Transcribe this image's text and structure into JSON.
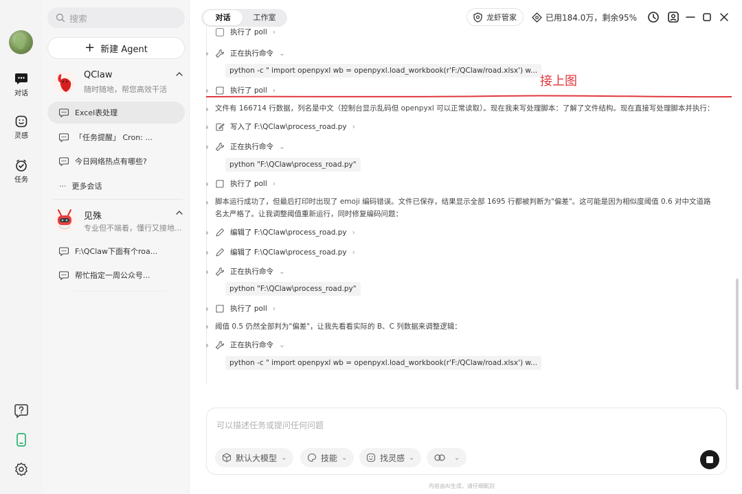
{
  "rail": {
    "items": [
      {
        "label": "对话",
        "icon": "chat-bubble-icon"
      },
      {
        "label": "灵感",
        "icon": "smile-icon"
      },
      {
        "label": "任务",
        "icon": "check-clock-icon"
      }
    ],
    "bottom_icons": [
      "help-icon",
      "phone-icon",
      "settings-icon"
    ]
  },
  "sidebar": {
    "search_placeholder": "搜索",
    "new_agent": "新建 Agent",
    "agents": [
      {
        "name": "QClaw",
        "desc": "随时随地，帮您高效干活",
        "conversations": [
          "Excel表处理",
          "「任务提醒」 Cron: ...",
          "今日网络热点有哪些?"
        ]
      },
      {
        "name": "见殊",
        "desc": "专业但不端着，懂行又接地...",
        "conversations": [
          "F:\\QClaw下面有个roa...",
          "帮忙指定一周公众号..."
        ]
      }
    ],
    "more": "更多会话",
    "active_conversation": "Excel表处理"
  },
  "header": {
    "tabs": [
      "对话",
      "工作室"
    ],
    "active_tab": "对话",
    "manager": "龙虾管家",
    "usage": "已用184.0万，剩余95%"
  },
  "timeline": {
    "annotation": "接上图",
    "annotation_color": "#e0383d",
    "items": {
      "r0": "执行了 poll",
      "r1": "正在执行命令",
      "c1": "python -c \" import openpyxl wb = openpyxl.load_workbook(r'F:/QClaw/road.xlsx') w...",
      "r2": "执行了 poll",
      "p1": "文件有 166714 行数据，列名是中文（控制台显示乱码但 openpyxl 可以正常读取）。现在我来写处理脚本：了解了文件结构。现在直接写处理脚本并执行：",
      "r3": "写入了 F:\\QClaw\\process_road.py",
      "r4": "正在执行命令",
      "c2": "python \"F:\\QClaw\\process_road.py\"",
      "r5": "执行了 poll",
      "p2a": "脚本运行成功了，但最后打印时出现了 emoji 编码错误。文件已保存，结果显示全部 1695 行都被判断为\"偏差\"。这可能是因为相似度阈值 0.6 对中文道路",
      "p2b": "名太严格了。让我调整阈值重新运行，同时修复编码问题：",
      "r6": "编辑了 F:\\QClaw\\process_road.py",
      "r7": "编辑了 F:\\QClaw\\process_road.py",
      "r8": "正在执行命令",
      "c3": "python \"F:\\QClaw\\process_road.py\"",
      "r9": "执行了 poll",
      "p3": "阈值 0.5 仍然全部判为\"偏差\"，让我先看看实际的 B、C 列数据来调整逻辑：",
      "r10": "正在执行命令",
      "c4": "python -c \" import openpyxl wb = openpyxl.load_workbook(r'F:/QClaw/road.xlsx') w..."
    }
  },
  "composer": {
    "placeholder": "可以描述任务或提问任何问题",
    "chips": [
      "默认大模型",
      "技能",
      "找灵感",
      ""
    ]
  },
  "footer": "内容由AI生成，请仔细甄别"
}
